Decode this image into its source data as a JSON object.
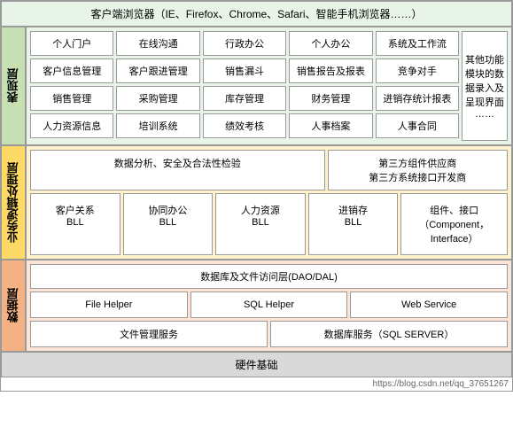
{
  "browser_bar": "客户端浏览器（IE、Firefox、Chrome、Safari、智能手机浏览器……）",
  "layers": {
    "presentation": {
      "label": "表现层",
      "grid": {
        "row1": [
          "个人门户",
          "在线沟通",
          "行政办公",
          "个人办公",
          "系统及工作流"
        ],
        "row2": [
          "客户信息管理",
          "客户跟进管理",
          "销售漏斗",
          "销售报告及报表",
          "竞争对手"
        ],
        "row3": [
          "销售管理",
          "采购管理",
          "库存管理",
          "财务管理",
          "进销存统计报表"
        ],
        "row4": [
          "人力资源信息",
          "培训系统",
          "绩效考核",
          "人事档案",
          "人事合同"
        ],
        "right_special": "其他功能模块的数据录入及呈现界面\n……"
      }
    },
    "business": {
      "label": "业务逻辑处理层",
      "top_left": "数据分析、安全及合法性检验",
      "top_right": "第三方组件供应商\n第三方系统接口开发商",
      "bll_items": [
        "客户关系\nBLL",
        "协同办公\nBLL",
        "人力资源\nBLL",
        "进销存\nBLL"
      ],
      "component": "组件、接口\n（Component，Interface）"
    },
    "data": {
      "label": "数据层",
      "dao_label": "数据库及文件访问层(DAO/DAL)",
      "helpers": [
        "File Helper",
        "SQL Helper",
        "Web Service"
      ],
      "services": [
        "文件管理服务",
        "数据库服务（SQL SERVER）"
      ]
    }
  },
  "hardware_bar": "硬件基础",
  "url": "https://blog.csdn.net/qq_37651267"
}
